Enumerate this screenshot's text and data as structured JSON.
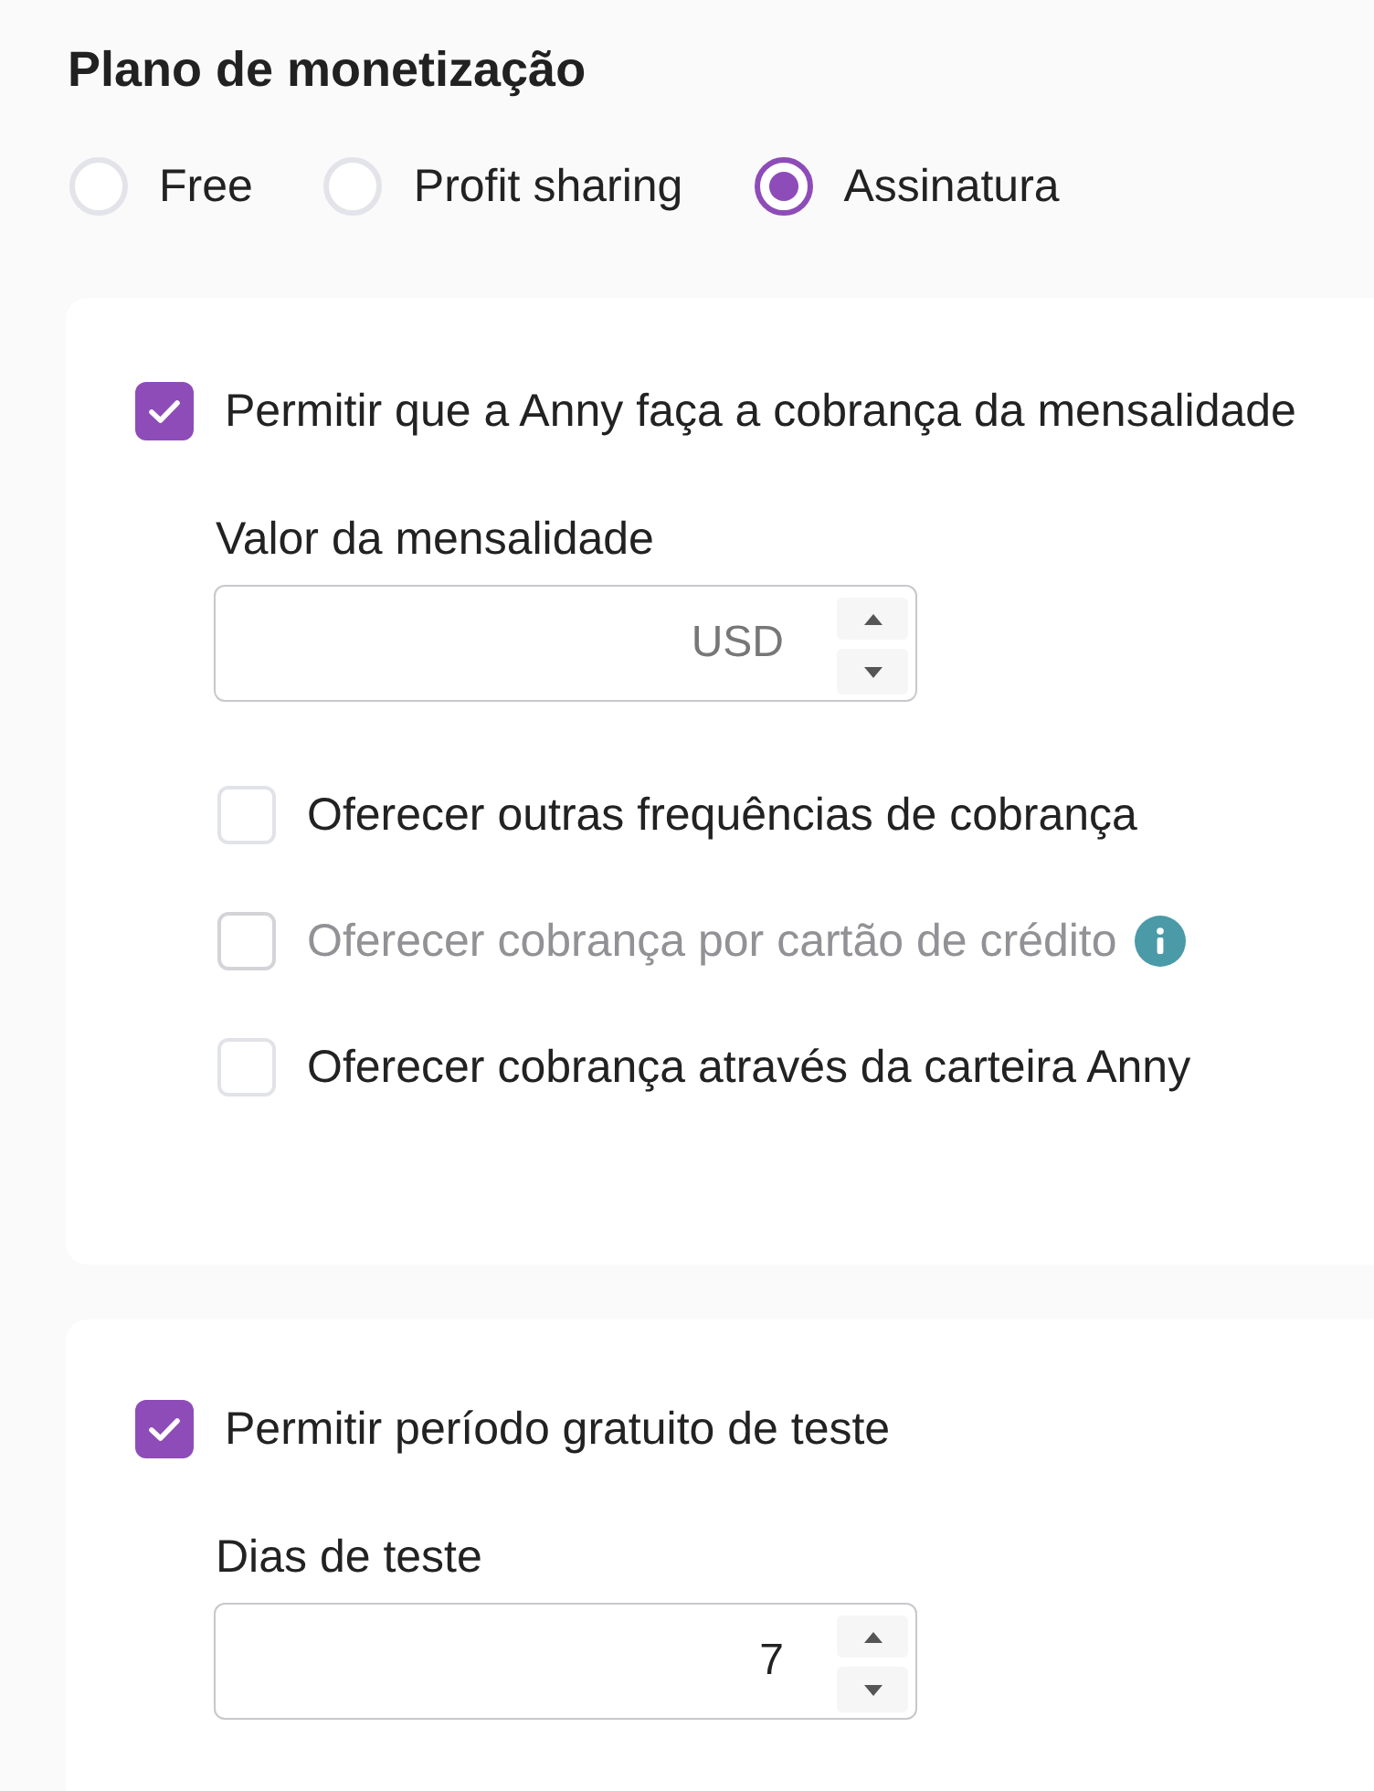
{
  "title": "Plano de monetização",
  "plan_options": [
    {
      "label": "Free",
      "selected": false
    },
    {
      "label": "Profit sharing",
      "selected": false
    },
    {
      "label": "Assinatura",
      "selected": true
    }
  ],
  "sections": [
    {
      "checkbox": {
        "label": "Permitir que a Anny faça a cobrança da mensalidade",
        "checked": true
      },
      "field": {
        "label": "Valor da mensalidade",
        "placeholder": "USD"
      },
      "options": [
        {
          "label": "Oferecer outras frequências de cobrança",
          "checked": false,
          "disabled": false
        },
        {
          "label": "Oferecer cobrança por cartão de crédito",
          "checked": false,
          "disabled": true,
          "info": true
        },
        {
          "label": "Oferecer cobrança através da carteira Anny",
          "checked": false,
          "disabled": false
        }
      ]
    },
    {
      "checkbox": {
        "label": "Permitir período gratuito de teste",
        "checked": true
      },
      "field": {
        "label": "Dias de teste",
        "value": "7"
      }
    }
  ]
}
